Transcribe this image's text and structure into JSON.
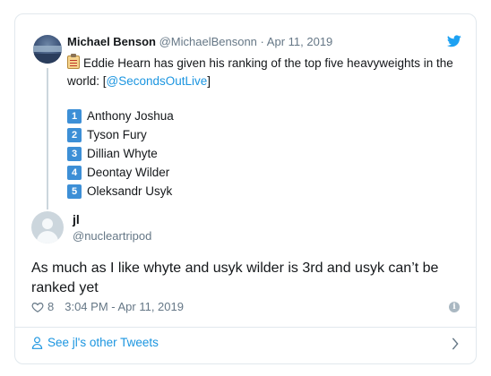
{
  "quoted": {
    "name": "Michael Benson",
    "handle": "@MichaelBensonn",
    "date": "Apr 11, 2019",
    "text_main": "Eddie Hearn has given his ranking of the top five heavyweights in the world: [",
    "link": "@SecondsOutLive",
    "text_end": "]",
    "rankings": [
      {
        "num": "1",
        "name": "Anthony Joshua"
      },
      {
        "num": "2",
        "name": "Tyson Fury"
      },
      {
        "num": "3",
        "name": "Dillian Whyte"
      },
      {
        "num": "4",
        "name": "Deontay Wilder"
      },
      {
        "num": "5",
        "name": "Oleksandr Usyk"
      }
    ]
  },
  "reply": {
    "name": "jl",
    "handle": "@nucleartripod",
    "text": "As much as I like whyte and usyk wilder is 3rd and usyk can’t be ranked yet",
    "likes": "8",
    "timestamp": "3:04 PM - Apr 11, 2019"
  },
  "footer": {
    "link_text": "See jl's other Tweets"
  },
  "colors": {
    "accent": "#1b95e0",
    "badge": "#3d8fd6",
    "muted": "#657786",
    "border": "#e1e8ed"
  }
}
